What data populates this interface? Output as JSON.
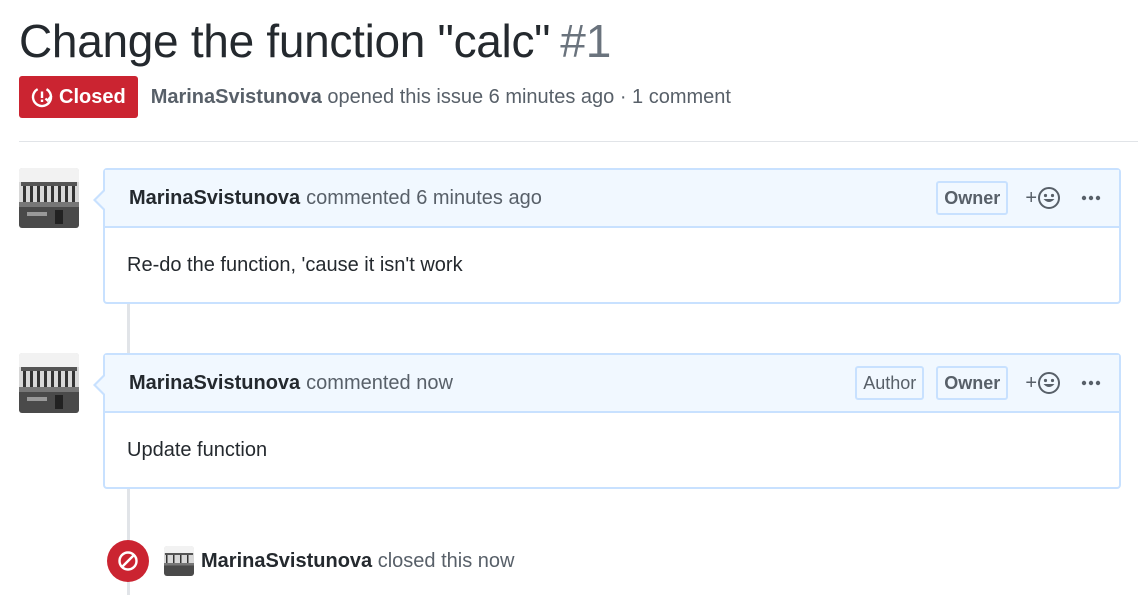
{
  "issue": {
    "title": "Change the function \"calc\"",
    "number": "#1",
    "state": "Closed",
    "state_color": "#cb2431",
    "author": "MarinaSvistunova",
    "opened_text": "opened this issue 6 minutes ago · 1 comment"
  },
  "comments": [
    {
      "author": "MarinaSvistunova",
      "action": "commented 6 minutes ago",
      "labels": [
        "Owner"
      ],
      "reaction": "+",
      "body": "Re-do the function, 'cause it isn't work"
    },
    {
      "author": "MarinaSvistunova",
      "action": "commented now",
      "labels": [
        "Author",
        "Owner"
      ],
      "reaction": "+",
      "body": "Update function"
    }
  ],
  "event": {
    "icon": "circle-slash-icon",
    "author": "MarinaSvistunova",
    "action": "closed this now"
  },
  "colors": {
    "accent_red": "#cb2431",
    "comment_border": "#c8e1ff",
    "comment_header_bg": "#f1f8ff"
  }
}
